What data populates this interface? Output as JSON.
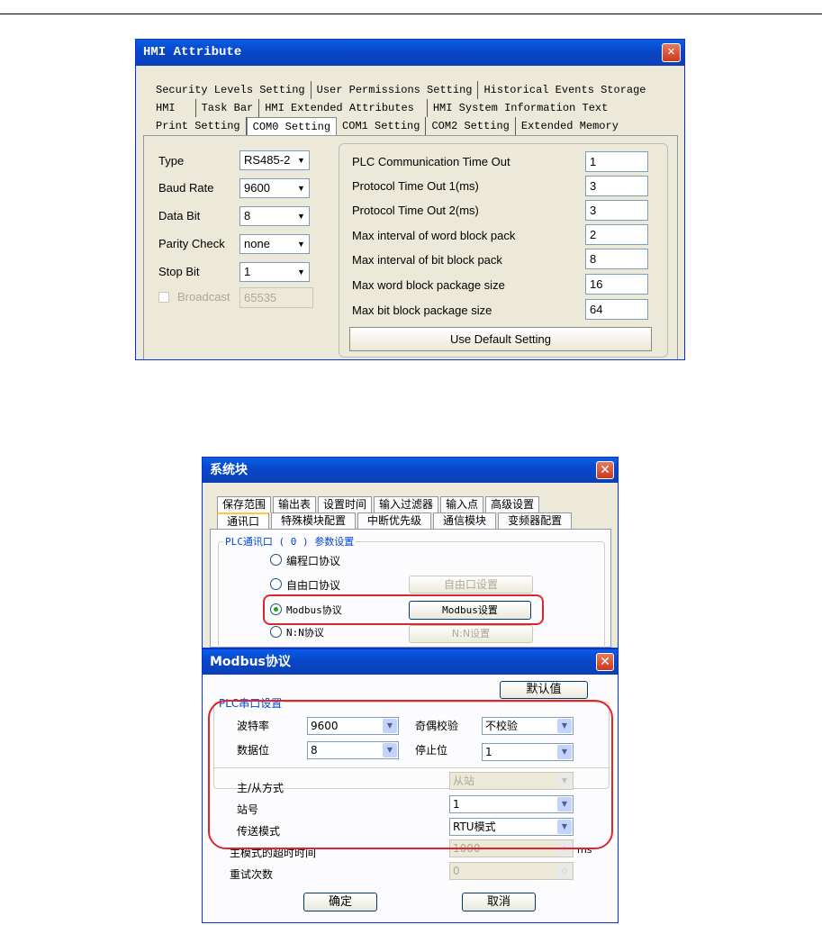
{
  "hmi": {
    "title": "HMI Attribute",
    "close": "✕",
    "tabs_row1": [
      "Security Levels Setting",
      "User Permissions Setting",
      "Historical Events Storage"
    ],
    "tabs_row2": [
      "HMI",
      "Task Bar",
      "HMI Extended Attributes",
      "HMI System Information Text"
    ],
    "tabs_row3": [
      "Print Setting",
      "COM0 Setting",
      "COM1 Setting",
      "COM2 Setting",
      "Extended Memory"
    ],
    "fields": [
      {
        "label": "Type",
        "value": "RS485-2"
      },
      {
        "label": "Baud Rate",
        "value": "9600"
      },
      {
        "label": "Data Bit",
        "value": "8"
      },
      {
        "label": "Parity Check",
        "value": "none"
      },
      {
        "label": "Stop Bit",
        "value": "1"
      }
    ],
    "broadcast_label": "Broadcast",
    "broadcast_value": "65535",
    "params": [
      {
        "label": "PLC Communication Time Out",
        "value": "1"
      },
      {
        "label": "Protocol Time Out 1(ms)",
        "value": "3"
      },
      {
        "label": "Protocol Time Out 2(ms)",
        "value": "3"
      },
      {
        "label": "Max interval of word block pack",
        "value": "2"
      },
      {
        "label": "Max interval of bit block pack",
        "value": "8"
      },
      {
        "label": "Max word block package size",
        "value": "16"
      },
      {
        "label": "Max bit block package size",
        "value": "64"
      }
    ],
    "default_button": "Use Default Setting"
  },
  "sysblock": {
    "title": "系统块",
    "tabs_row1": [
      "保存范围",
      "输出表",
      "设置时间",
      "输入过滤器",
      "输入点",
      "高级设置"
    ],
    "tabs_row2": [
      "通讯口",
      "特殊模块配置",
      "中断优先级",
      "通信模块",
      "变频器配置"
    ],
    "group_label": "PLC通讯口 ( 0 ) 参数设置",
    "options": [
      "编程口协议",
      "自由口协议",
      "Modbus协议",
      "N:N协议"
    ],
    "freeport_button": "自由口设置",
    "modbus_button": "Modbus设置",
    "nn_button": "N:N设置"
  },
  "modbus": {
    "title": "Modbus协议",
    "default_button": "默认值",
    "group_label": "PLC串口设置",
    "baud_label": "波特率",
    "baud_value": "9600",
    "parity_label": "奇偶校验",
    "parity_value": "不校验",
    "databit_label": "数据位",
    "databit_value": "8",
    "stopbit_label": "停止位",
    "stopbit_value": "1",
    "mode_label": "主/从方式",
    "mode_value": "从站",
    "station_label": "站号",
    "station_value": "1",
    "transfer_label": "传送模式",
    "transfer_value": "RTU模式",
    "timeout_label": "主模式的超时时间",
    "timeout_value": "1000",
    "timeout_unit": "ms",
    "retry_label": "重试次数",
    "retry_value": "0",
    "ok_button": "确定",
    "cancel_button": "取消"
  }
}
